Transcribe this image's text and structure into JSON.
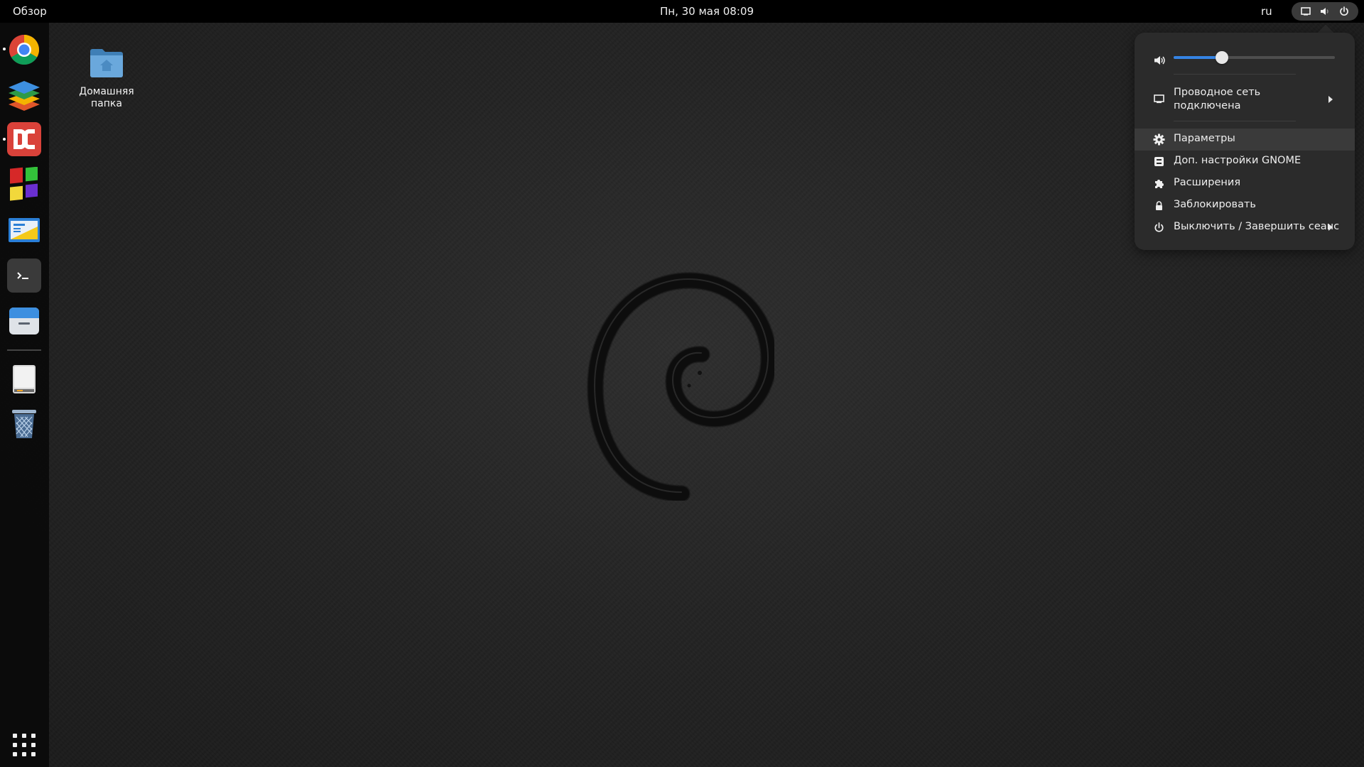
{
  "topbar": {
    "activities": "Обзор",
    "clock": "Пн, 30 мая  08:09",
    "language": "ru",
    "status_icons": [
      "network-wired-icon",
      "volume-icon",
      "power-icon"
    ]
  },
  "dock": {
    "apps": [
      {
        "name": "chrome-icon",
        "running": true
      },
      {
        "name": "layers-app-icon",
        "running": false
      },
      {
        "name": "dc-app-icon",
        "running": true
      },
      {
        "name": "colorful-cards-app-icon",
        "running": false
      },
      {
        "name": "presentation-app-icon",
        "running": false
      },
      {
        "name": "terminal-icon",
        "running": false
      },
      {
        "name": "files-app-icon",
        "running": false
      },
      {
        "name": "drive-icon",
        "running": false
      },
      {
        "name": "trash-icon",
        "running": false
      }
    ],
    "show_apps": "app-grid-icon"
  },
  "desktop": {
    "home_folder_label": "Домашняя папка"
  },
  "system_menu": {
    "volume_level": 0.3,
    "network": {
      "label": "Проводное сеть подключена",
      "icon": "network-wired-icon"
    },
    "items": [
      {
        "label": "Параметры",
        "icon": "gear-icon",
        "highlighted": true,
        "submenu": false
      },
      {
        "label": "Доп. настройки GNOME",
        "icon": "tweaks-icon",
        "highlighted": false,
        "submenu": false
      },
      {
        "label": "Расширения",
        "icon": "puzzle-icon",
        "highlighted": false,
        "submenu": false
      },
      {
        "label": "Заблокировать",
        "icon": "lock-icon",
        "highlighted": false,
        "submenu": false
      },
      {
        "label": "Выключить / Завершить сеанс",
        "icon": "power-icon",
        "highlighted": false,
        "submenu": true
      }
    ]
  },
  "colors": {
    "accent": "#3584e4",
    "menu_bg": "#2b2b2b",
    "topbar_bg": "#000000"
  }
}
